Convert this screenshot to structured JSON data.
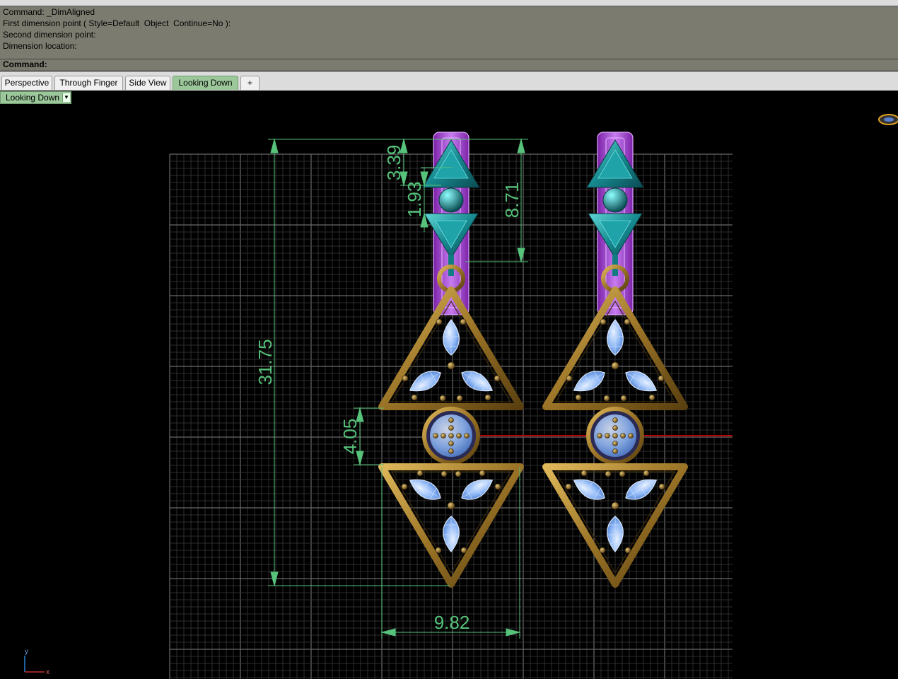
{
  "command_history": [
    "Command: _DimAligned",
    "First dimension point ( Style=Default  Object  Continue=No ):",
    "Second dimension point:",
    "Dimension location:"
  ],
  "command_prompt": "Command:",
  "tabs": [
    "Perspective",
    "Through Finger",
    "Side View",
    "Looking Down"
  ],
  "add_tab_glyph": "+",
  "active_tab": "Looking Down",
  "viewport_label": "Looking Down",
  "dimensions": {
    "dim1": "3.39",
    "dim2": "1.93",
    "dim3": "8.71",
    "dim4": "31.75",
    "dim5": "4.05",
    "dim6": "9.82"
  },
  "axes": {
    "x": "x",
    "y": "y"
  },
  "colors": {
    "background": "#000000",
    "grid": "#4a4a4a",
    "dimension": "#56c27a",
    "gold": "#a8802c",
    "teal": "#178a90",
    "purple": "#a64fd0",
    "gem": "#9ec4ff",
    "x_axis": "#b00000"
  }
}
